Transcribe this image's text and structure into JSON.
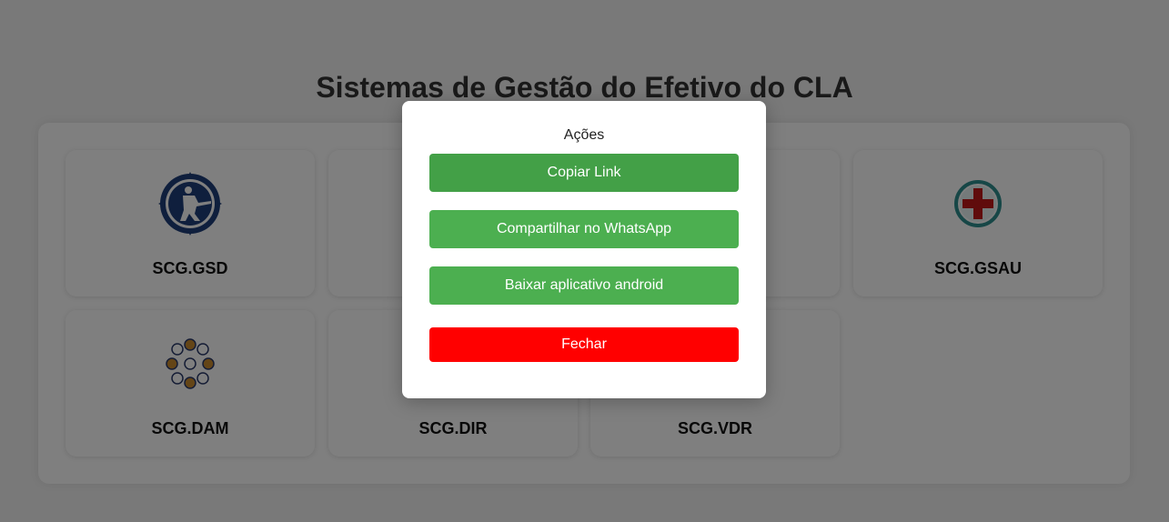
{
  "page": {
    "title": "Sistemas de Gestão do Efetivo do CLA"
  },
  "cards": [
    {
      "label": "SCG.GSD",
      "icon": "soldier-emblem-icon"
    },
    {
      "label": "",
      "icon": ""
    },
    {
      "label": "",
      "icon": ""
    },
    {
      "label": "SCG.GSAU",
      "icon": "medical-cross-icon"
    },
    {
      "label": "SCG.DAM",
      "icon": "circle-dots-icon"
    },
    {
      "label": "SCG.DIR",
      "icon": ""
    },
    {
      "label": "SCG.VDR",
      "icon": ""
    }
  ],
  "modal": {
    "title": "Ações",
    "copy_label": "Copiar Link",
    "whatsapp_label": "Compartilhar no WhatsApp",
    "android_label": "Baixar aplicativo android",
    "close_label": "Fechar"
  },
  "colors": {
    "copy": "#43a047",
    "share": "#4caf50",
    "close": "#ff0000",
    "overlay": "rgba(0,0,0,0.5)"
  }
}
